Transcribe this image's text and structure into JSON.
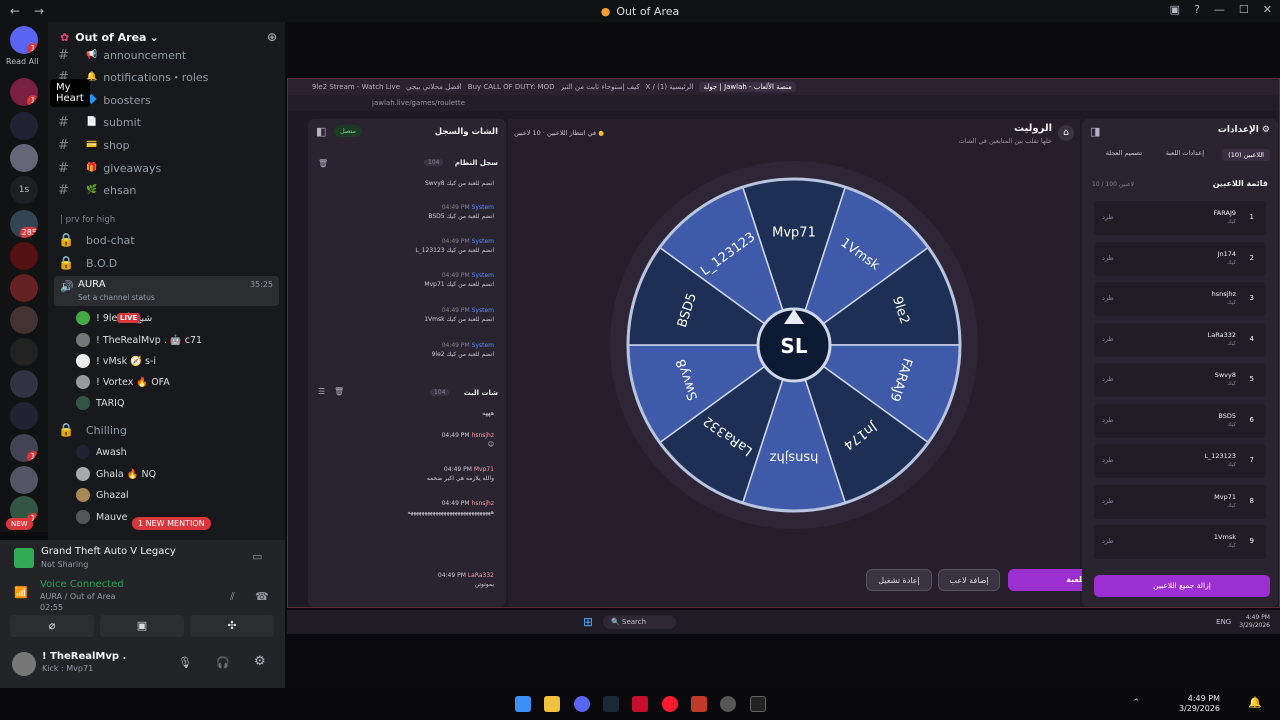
{
  "window": {
    "title": "Out of Area",
    "nav_back": "←",
    "nav_fwd": "→"
  },
  "rail": {
    "read_all": "Read All",
    "tooltip": "My Heart",
    "new_badge": "NEW",
    "badges": [
      "1",
      "1",
      "285",
      "1",
      "1"
    ],
    "label_1s": "1s"
  },
  "server": {
    "name": "Out of Area"
  },
  "channels": [
    {
      "name": "announcement",
      "emoji": "📢"
    },
    {
      "name": "notifications・roles",
      "emoji": "🔔"
    },
    {
      "name": "boosters",
      "emoji": "🔷"
    },
    {
      "name": "submit",
      "emoji": "📄"
    },
    {
      "name": "shop",
      "emoji": "💳"
    },
    {
      "name": "giveaways",
      "emoji": "🎁"
    },
    {
      "name": "ehsan",
      "emoji": "🌿"
    }
  ],
  "category_prv": "| prv for high",
  "locked": [
    "bod-chat",
    "B.O.D"
  ],
  "voice": {
    "aura": {
      "name": "AURA",
      "time": "35:25",
      "status": "Set a channel status"
    },
    "users": [
      {
        "name": "! 9le 🎤 شبح",
        "live": "LIVE"
      },
      {
        "name": "! TheRealMvp . 🤖 c71"
      },
      {
        "name": "! vMsk 🧭 s-i"
      },
      {
        "name": "! Vortex 🔥 OFA"
      },
      {
        "name": "TARIQ"
      }
    ],
    "chilling": "Chilling",
    "chill_users": [
      "Awash",
      "Ghala 🔥 NQ",
      "Ghazal",
      "Mauve"
    ]
  },
  "mention": "1 NEW MENTION",
  "panel": {
    "game": "Grand Theft Auto V Legacy",
    "game_sub": "Not Sharing",
    "voice": "Voice Connected",
    "voice_sub": "AURA / Out of Area",
    "voice_time": "02:55",
    "user": "! TheRealMvp .",
    "user_sub": "Kick : Mvp71"
  },
  "browser": {
    "tabs": [
      "9le2 Stream - Watch Live",
      "أفضل محلاتي بيجي",
      "Buy CALL OF DUTY: MOD",
      "كيف إستوحاء ثابت من التيز",
      "X / الرئيسية (1)",
      "جولة | Jawlah - منصة الألعاب"
    ],
    "url": "jawlah.live/games/roulette"
  },
  "chat": {
    "title": "الشات والسجل",
    "status": "متصل",
    "log_title": "سجل النظام",
    "log_count": "104",
    "system_name": "System",
    "time": "04:49 PM",
    "log": [
      "Swvy8 انضم للعبة من كيك",
      "BSD5 انضم للعبة من كيك",
      "L_123123 انضم للعبة من كيك",
      "Mvp71 انضم للعبة من كيك",
      "1Vmsk انضم للعبة من كيك",
      "9le2 انضم للعبة من كيك"
    ],
    "live_title": "شات البث",
    "live_count": "104",
    "live": [
      {
        "user": "hsnsjhz",
        "text": "😊"
      },
      {
        "user": "Mvp71",
        "text": "والله يلازمه هي اكبر ضحمه"
      },
      {
        "user": "hsnsjhz",
        "text": "ههههههههههههههههههههههههههههههه"
      },
      {
        "user": "LaRa332",
        "text": "يموتوتن"
      }
    ],
    "live_first": "هههه"
  },
  "game": {
    "title": "الروليت",
    "subtitle": "خلها تقلب بين المتابعين في الشات",
    "players_label": "10 لاعبين",
    "status": "في انتظار اللاعبين",
    "wheel_segments": [
      "Mvp71",
      "1Vmsk",
      "9le2",
      "FARAJ9",
      "Jn174",
      "hsnsjhz",
      "LaRa332",
      "Swvy8",
      "BSD5",
      "L_123123"
    ],
    "logo": "SL",
    "start": "ابدأ اللعبة",
    "add": "إضافة لاعب",
    "reset": "إعادة تشغيل"
  },
  "settings": {
    "title": "الإعدادات",
    "tabs": [
      "اللاعبين (10)",
      "إعدادات اللعبة",
      "تصميم العجلة"
    ],
    "list_title": "قائمة اللاعبين",
    "count": "10 / 100 لاعبين",
    "kick": "طرد",
    "platform": "كيك",
    "players": [
      "FARAJ9",
      "Jn174",
      "hsnsjhz",
      "LaRa332",
      "Swvy8",
      "BSD5",
      "L_123123",
      "Mvp71",
      "1Vmsk"
    ],
    "remove_all": "إزالة جميع اللاعبين"
  },
  "taskbar": {
    "search": "Search",
    "lang": "ENG",
    "time": "4:49 PM",
    "date": "3/29/2026"
  },
  "colors": {
    "accent": "#9b2fd1",
    "wheel_light": "#3e5aa8",
    "wheel_dark": "#1e2f55",
    "live": "#da373c"
  }
}
